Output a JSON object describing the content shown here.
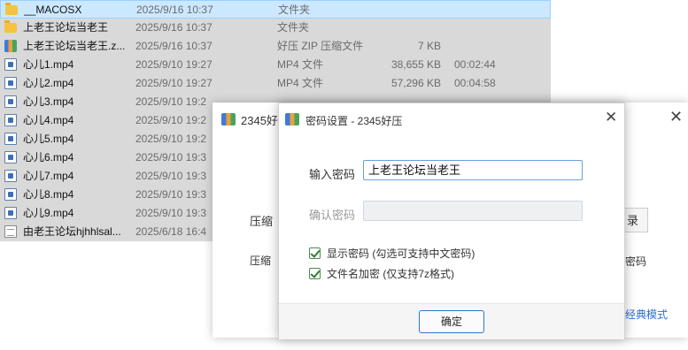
{
  "files": [
    {
      "icon": "folder-icon",
      "name": "__MACOSX",
      "date": "2025/9/16 10:37",
      "type": "文件夹",
      "size": "",
      "duration": ""
    },
    {
      "icon": "folder-icon",
      "name": "上老王论坛当老王",
      "date": "2025/9/16 10:37",
      "type": "文件夹",
      "size": "",
      "duration": ""
    },
    {
      "icon": "zip-icon",
      "name": "上老王论坛当老王.z...",
      "date": "2025/9/16 10:37",
      "type": "好压 ZIP 压缩文件",
      "size": "7 KB",
      "duration": ""
    },
    {
      "icon": "video-icon",
      "name": "心儿1.mp4",
      "date": "2025/9/10 19:27",
      "type": "MP4 文件",
      "size": "38,655 KB",
      "duration": "00:02:44"
    },
    {
      "icon": "video-icon",
      "name": "心儿2.mp4",
      "date": "2025/9/10 19:27",
      "type": "MP4 文件",
      "size": "57,296 KB",
      "duration": "00:04:58"
    },
    {
      "icon": "video-icon",
      "name": "心儿3.mp4",
      "date": "2025/9/10 19:2",
      "type": "",
      "size": "",
      "duration": ""
    },
    {
      "icon": "video-icon",
      "name": "心儿4.mp4",
      "date": "2025/9/10 19:2",
      "type": "",
      "size": "",
      "duration": ""
    },
    {
      "icon": "video-icon",
      "name": "心儿5.mp4",
      "date": "2025/9/10 19:2",
      "type": "",
      "size": "",
      "duration": ""
    },
    {
      "icon": "video-icon",
      "name": "心儿6.mp4",
      "date": "2025/9/10 19:3",
      "type": "",
      "size": "",
      "duration": ""
    },
    {
      "icon": "video-icon",
      "name": "心儿7.mp4",
      "date": "2025/9/10 19:3",
      "type": "",
      "size": "",
      "duration": ""
    },
    {
      "icon": "video-icon",
      "name": "心儿8.mp4",
      "date": "2025/9/10 19:3",
      "type": "",
      "size": "",
      "duration": ""
    },
    {
      "icon": "video-icon",
      "name": "心儿9.mp4",
      "date": "2025/9/10 19:3",
      "type": "",
      "size": "",
      "duration": ""
    },
    {
      "icon": "text-file-icon",
      "name": "由老王论坛hjhhlsal...",
      "date": "2025/6/18 16:4",
      "type": "",
      "size": "",
      "duration": ""
    }
  ],
  "back_window": {
    "title": "2345好",
    "close": "✕",
    "label_compress": "压缩",
    "label_compress2": "压缩",
    "button_partial": "录",
    "text_partial": "密码",
    "link_classic": "经典模式"
  },
  "dialog": {
    "title": "密码设置 - 2345好压",
    "close": "✕",
    "password_label": "输入密码",
    "password_value": "上老王论坛当老王",
    "confirm_label": "确认密码",
    "confirm_value": "",
    "show_password_label": "显示密码 (勾选可支持中文密码)",
    "show_password_checked": true,
    "encrypt_names_label": "文件名加密 (仅支持7z格式)",
    "encrypt_names_checked": true,
    "ok_label": "确定"
  },
  "colors": {
    "selected_row": "#cce8ff",
    "list_background": "#d9d9d9",
    "link": "#2a6fd6",
    "checkbox_check": "#2e7d32"
  }
}
